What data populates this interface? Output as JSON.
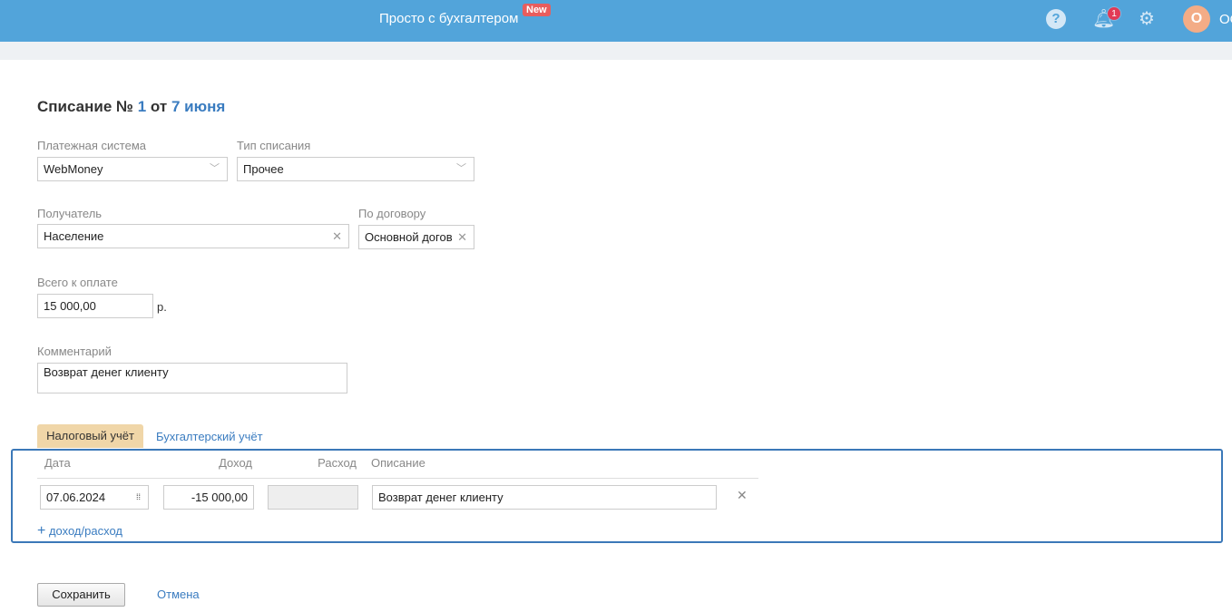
{
  "header": {
    "brand": "Просто с бухгалтером",
    "new_badge": "New",
    "notifications": "1",
    "avatar_letter": "О",
    "user_name": "ОО"
  },
  "doc": {
    "title_prefix": "Списание №",
    "number": "1",
    "from": "от",
    "date": "7 июня"
  },
  "fields": {
    "payment_system": {
      "label": "Платежная система",
      "value": "WebMoney"
    },
    "writeoff_type": {
      "label": "Тип списания",
      "value": "Прочее"
    },
    "recipient": {
      "label": "Получатель",
      "value": "Население"
    },
    "contract": {
      "label": "По договору",
      "value": "Основной догов"
    },
    "total": {
      "label": "Всего к оплате",
      "value": "15 000,00",
      "currency": "р."
    },
    "comment": {
      "label": "Комментарий",
      "value": "Возврат денег клиенту"
    }
  },
  "tabs": [
    {
      "label": "Налоговый учёт",
      "active": true
    },
    {
      "label": "Бухгалтерский учёт",
      "active": false
    }
  ],
  "table": {
    "headers": [
      "Дата",
      "Доход",
      "Расход",
      "Описание"
    ],
    "rows": [
      {
        "date": "07.06.2024",
        "income": "-15 000,00",
        "expense": "",
        "description": "Возврат денег клиенту"
      }
    ],
    "add_label": "доход/расход"
  },
  "actions": {
    "save": "Сохранить",
    "cancel": "Отмена"
  }
}
